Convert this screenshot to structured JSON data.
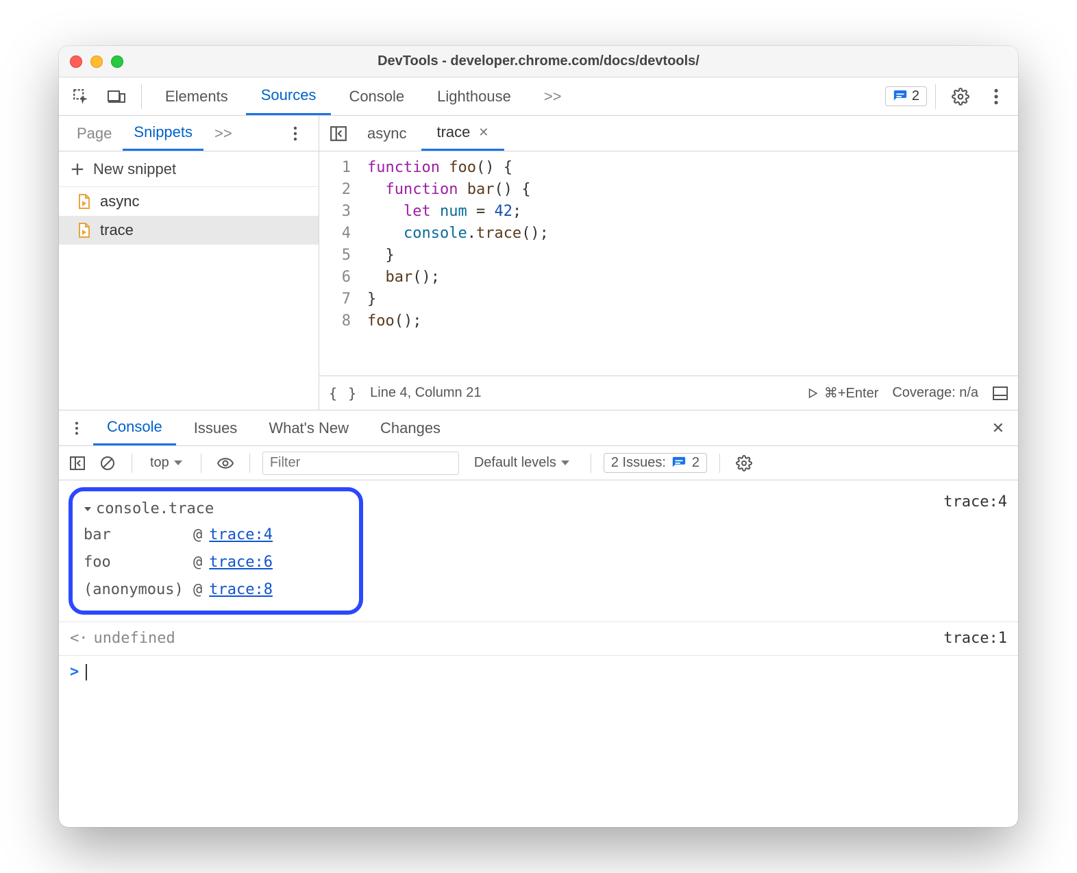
{
  "window": {
    "title": "DevTools - developer.chrome.com/docs/devtools/"
  },
  "main_tabs": {
    "items": [
      "Elements",
      "Sources",
      "Console",
      "Lighthouse"
    ],
    "active": 1,
    "overflow": ">>",
    "issues_count": "2"
  },
  "sidebar": {
    "tabs": {
      "page": "Page",
      "snippets": "Snippets",
      "overflow": ">>"
    },
    "new_snippet": "New snippet",
    "files": [
      "async",
      "trace"
    ],
    "selected": 1
  },
  "editor": {
    "tabs": {
      "inactive": "async",
      "active": "trace"
    },
    "code_lines": [
      "function foo() {",
      "  function bar() {",
      "    let num = 42;",
      "    console.trace();",
      "  }",
      "  bar();",
      "}",
      "foo();"
    ],
    "status": {
      "cursor": "Line 4, Column 21",
      "run": "⌘+Enter",
      "coverage": "Coverage: n/a"
    }
  },
  "drawer": {
    "tabs": [
      "Console",
      "Issues",
      "What's New",
      "Changes"
    ],
    "active": 0
  },
  "console_toolbar": {
    "context": "top",
    "filter_placeholder": "Filter",
    "levels": "Default levels",
    "issues_label": "2 Issues:",
    "issues_count": "2"
  },
  "console": {
    "trace_header": "console.trace",
    "trace_source": "trace:4",
    "stack": [
      {
        "fn": "bar",
        "loc": "trace:4"
      },
      {
        "fn": "foo",
        "loc": "trace:6"
      },
      {
        "fn": "(anonymous)",
        "loc": "trace:8"
      }
    ],
    "return": {
      "value": "undefined",
      "source": "trace:1"
    }
  }
}
